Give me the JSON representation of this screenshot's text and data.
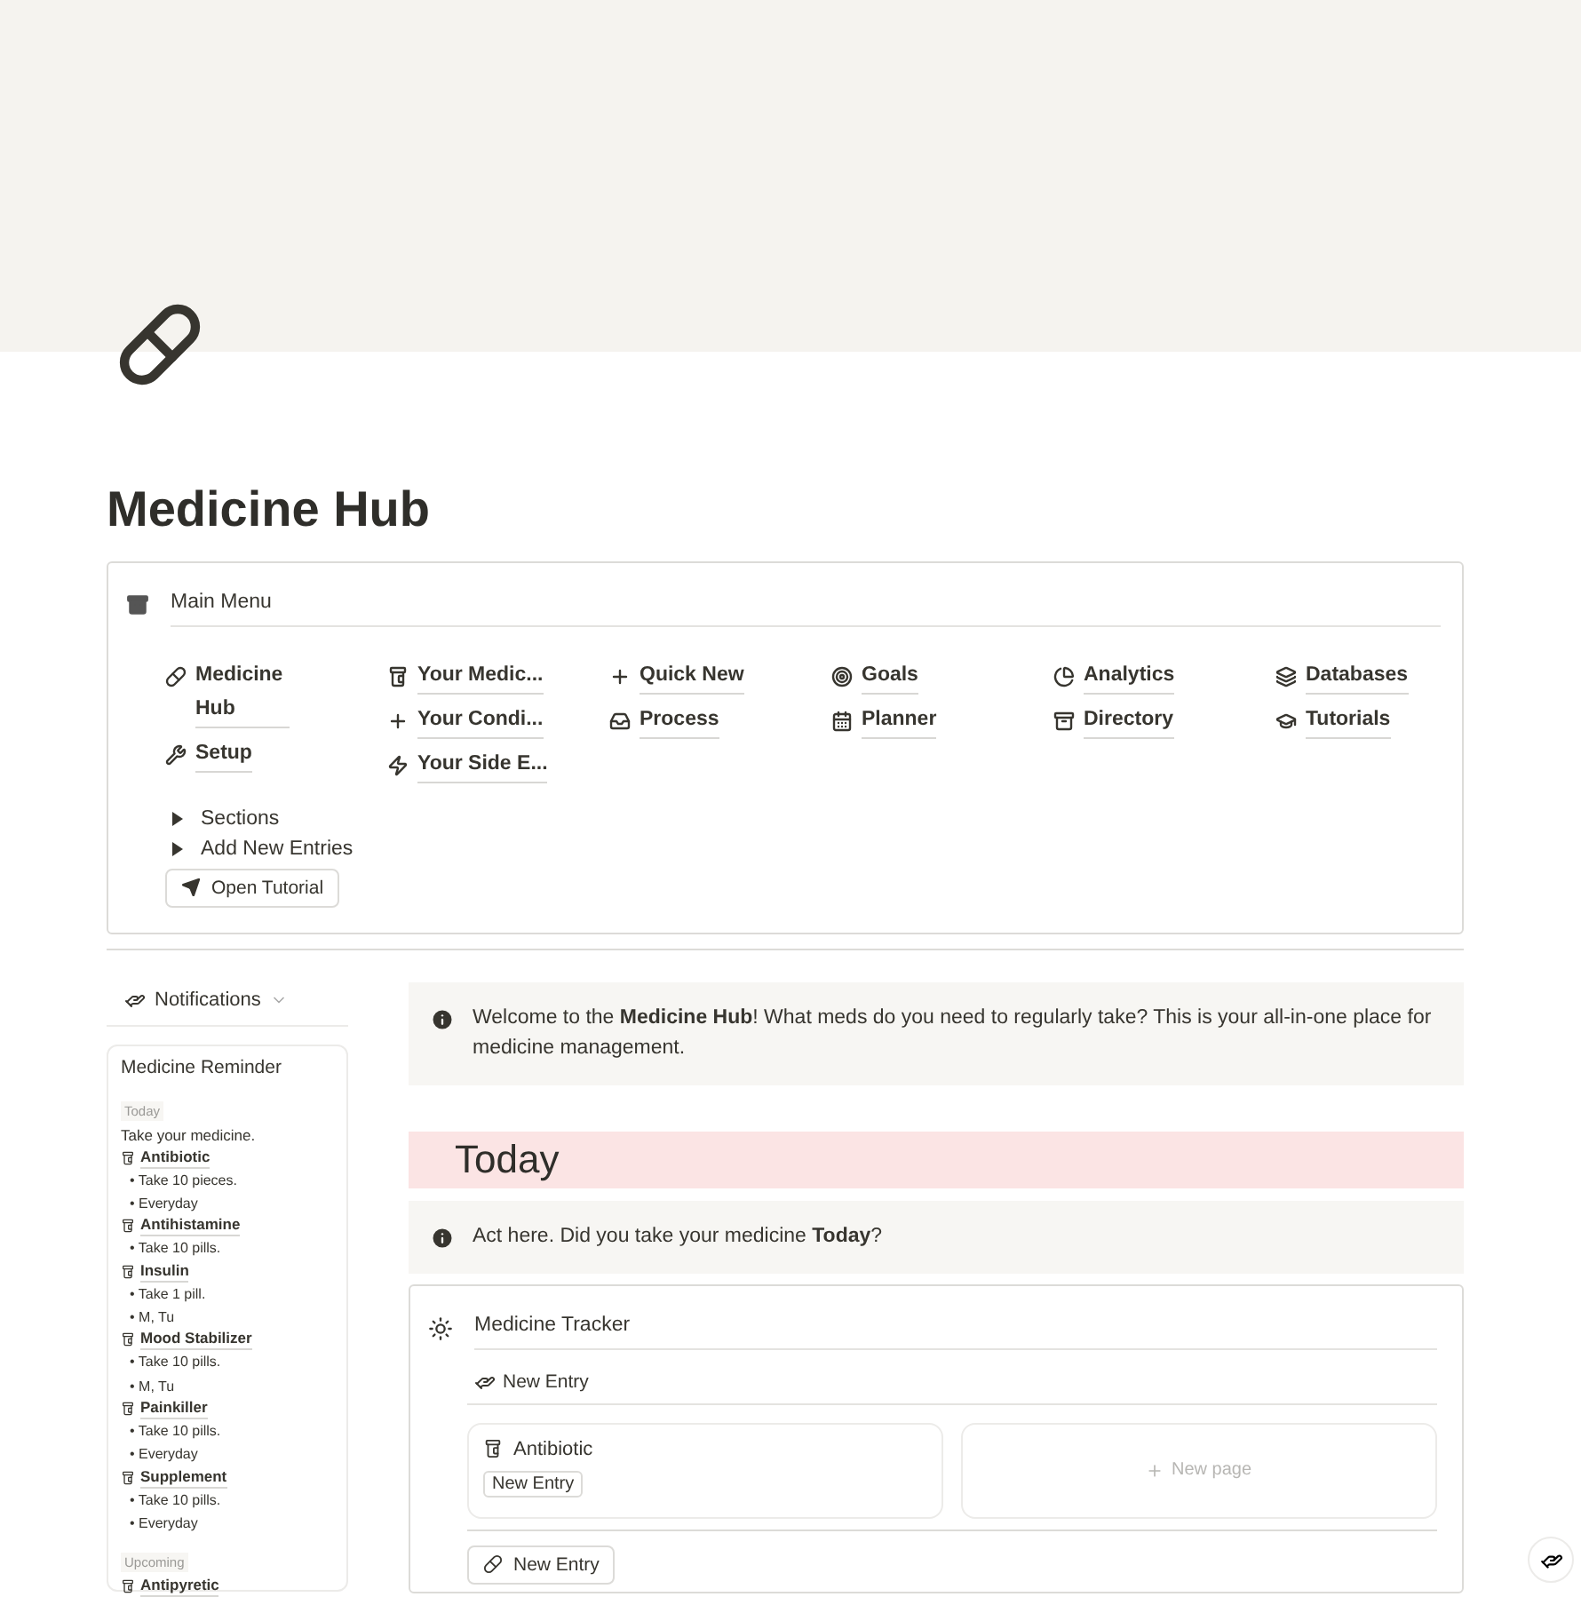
{
  "page": {
    "title": "Medicine Hub"
  },
  "main_menu": {
    "title": "Main Menu",
    "columns": [
      [
        {
          "label": "Medicine Hub"
        },
        {
          "label": "Setup"
        }
      ],
      [
        {
          "label": "Your Medic..."
        },
        {
          "label": "Your Condi..."
        },
        {
          "label": "Your Side E..."
        }
      ],
      [
        {
          "label": "Quick New"
        },
        {
          "label": "Process"
        }
      ],
      [
        {
          "label": "Goals"
        },
        {
          "label": "Planner"
        }
      ],
      [
        {
          "label": "Analytics"
        },
        {
          "label": "Directory"
        }
      ],
      [
        {
          "label": "Databases"
        },
        {
          "label": "Tutorials"
        }
      ]
    ],
    "toggles": [
      {
        "label": "Sections",
        "expanded": false
      },
      {
        "label": "Add New Entries",
        "expanded": false
      }
    ],
    "tutorial_button": "Open Tutorial"
  },
  "notifications": {
    "label": "Notifications"
  },
  "reminder": {
    "title": "Medicine Reminder",
    "groups": [
      {
        "label": "Today",
        "note": "Take your medicine.",
        "items": [
          {
            "name": "Antibiotic",
            "details": [
              "• Take 10 pieces.",
              "• Everyday"
            ]
          },
          {
            "name": "Antihistamine",
            "details": [
              "• Take 10 pills."
            ]
          },
          {
            "name": "Insulin",
            "details": [
              "• Take 1 pill.",
              "• M, Tu"
            ]
          },
          {
            "name": "Mood Stabilizer",
            "details": [
              "• Take 10 pills.",
              "• M, Tu"
            ]
          },
          {
            "name": "Painkiller",
            "details": [
              "• Take 10 pills.",
              "• Everyday"
            ]
          },
          {
            "name": "Supplement",
            "details": [
              "• Take 10 pills.",
              "• Everyday"
            ]
          }
        ]
      },
      {
        "label": "Upcoming",
        "items": [
          {
            "name": "Antipyretic"
          }
        ]
      }
    ]
  },
  "welcome_callout": "Welcome to the **Medicine Hub**! What meds do you need to regularly take? This is your all-in-one place for medicine management.",
  "today_heading": "Today",
  "act_callout": "Act here. Did you take your medicine **Today**?",
  "tracker": {
    "title": "Medicine Tracker",
    "new_entry_link": "New Entry",
    "cards": [
      {
        "title": "Antibiotic",
        "tag": "New Entry"
      }
    ],
    "new_page": "New page",
    "new_entry_button": "New Entry"
  }
}
